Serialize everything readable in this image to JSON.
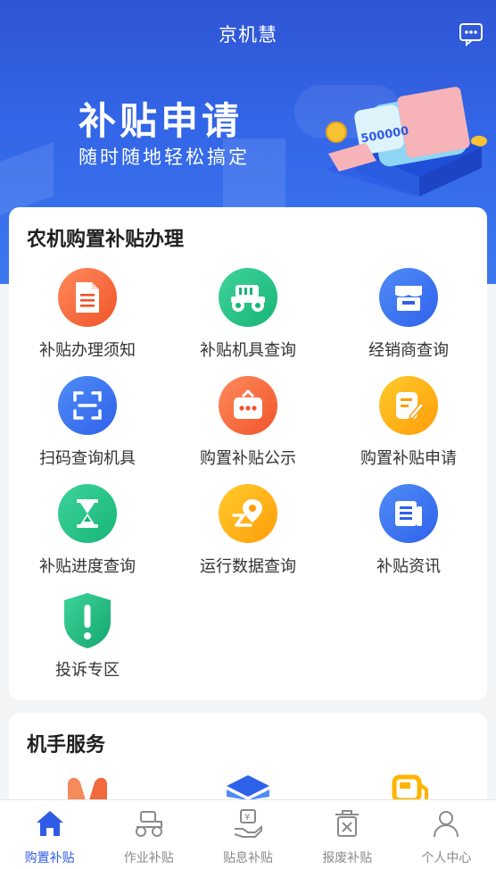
{
  "header": {
    "title": "京机慧",
    "message_icon": "message-icon"
  },
  "banner": {
    "title": "补贴申请",
    "subtitle": "随时随地轻松搞定",
    "amount": "500000"
  },
  "section1": {
    "title": "农机购置补贴办理",
    "items": [
      {
        "label": "补贴办理须知",
        "icon": "document-icon"
      },
      {
        "label": "补贴机具查询",
        "icon": "tractor-icon"
      },
      {
        "label": "经销商查询",
        "icon": "store-icon"
      },
      {
        "label": "扫码查询机具",
        "icon": "scan-icon"
      },
      {
        "label": "购置补贴公示",
        "icon": "announcement-icon"
      },
      {
        "label": "购置补贴申请",
        "icon": "edit-form-icon"
      },
      {
        "label": "补贴进度查询",
        "icon": "hourglass-icon"
      },
      {
        "label": "运行数据查询",
        "icon": "location-route-icon"
      },
      {
        "label": "补贴资讯",
        "icon": "news-icon"
      },
      {
        "label": "投诉专区",
        "icon": "complaint-shield-icon"
      }
    ]
  },
  "section2": {
    "title": "机手服务"
  },
  "tabbar": [
    {
      "label": "购置补贴",
      "icon": "home-icon",
      "active": true
    },
    {
      "label": "作业补贴",
      "icon": "tractor-icon",
      "active": false
    },
    {
      "label": "贴息补贴",
      "icon": "yen-hand-icon",
      "active": false
    },
    {
      "label": "报废补贴",
      "icon": "trash-icon",
      "active": false
    },
    {
      "label": "个人中心",
      "icon": "user-icon",
      "active": false
    }
  ],
  "colors": {
    "primary": "#2f5be7",
    "orange": "#f0542a",
    "green": "#17b477",
    "yellow": "#ff9d0a"
  }
}
